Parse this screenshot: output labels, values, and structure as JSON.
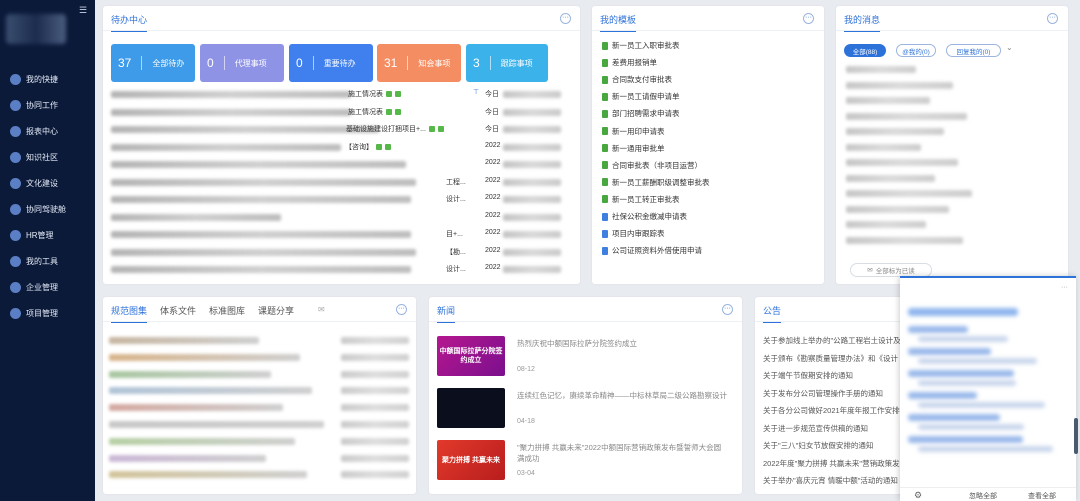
{
  "sidebar": {
    "items": [
      {
        "label": "我的快捷",
        "icon": "shortcut-icon"
      },
      {
        "label": "协同工作",
        "icon": "collaboration-icon"
      },
      {
        "label": "报表中心",
        "icon": "report-icon"
      },
      {
        "label": "知识社区",
        "icon": "graduation-cap-icon"
      },
      {
        "label": "文化建设",
        "icon": "culture-icon"
      },
      {
        "label": "协同驾驶舱",
        "icon": "cockpit-icon"
      },
      {
        "label": "HR管理",
        "icon": "hr-icon"
      },
      {
        "label": "我的工具",
        "icon": "toolbox-icon"
      },
      {
        "label": "企业管理",
        "icon": "enterprise-icon"
      },
      {
        "label": "项目管理",
        "icon": "project-icon"
      }
    ]
  },
  "todo": {
    "title": "待办中心",
    "tiles": [
      {
        "count": "37",
        "label": "全部待办",
        "color": "#3d9be9"
      },
      {
        "count": "0",
        "label": "代理事项",
        "color": "#8f93e6"
      },
      {
        "count": "0",
        "label": "重要待办",
        "color": "#3f80ee"
      },
      {
        "count": "31",
        "label": "知会事项",
        "color": "#f58d63"
      },
      {
        "count": "3",
        "label": "跟踪事项",
        "color": "#3cb2ea"
      }
    ],
    "rows": [
      {
        "title": "施工情况表",
        "date": "今日"
      },
      {
        "title": "施工情况表",
        "date": "今日"
      },
      {
        "title": "基础设施建设打捆项目+...",
        "date": "今日"
      },
      {
        "title": "【咨询】",
        "date": "2022"
      },
      {
        "title": "",
        "date": "2022"
      },
      {
        "title": "工程...",
        "date": "2022"
      },
      {
        "title": "设计...",
        "date": "2022"
      },
      {
        "title": "",
        "date": "2022"
      },
      {
        "title": "目+...",
        "date": "2022"
      },
      {
        "title": "【勘...",
        "date": "2022"
      },
      {
        "title": "设计...",
        "date": "2022"
      }
    ]
  },
  "templates": {
    "title": "我的模板",
    "items": [
      {
        "label": "新一员工入职审批表",
        "color": "green"
      },
      {
        "label": "差费用报销单",
        "color": "green"
      },
      {
        "label": "合同款支付审批表",
        "color": "green"
      },
      {
        "label": "新一员工请假申请单",
        "color": "green"
      },
      {
        "label": "部门招聘需求申请表",
        "color": "green"
      },
      {
        "label": "新一用印申请表",
        "color": "green"
      },
      {
        "label": "新一通用审批单",
        "color": "green"
      },
      {
        "label": "合同审批表（非项目运营）",
        "color": "green"
      },
      {
        "label": "新一员工薪酬职级调整审批表",
        "color": "green"
      },
      {
        "label": "新一员工转正审批表",
        "color": "green"
      },
      {
        "label": "社保公积金缴减申请表",
        "color": "blue"
      },
      {
        "label": "项目内审跟踪表",
        "color": "blue"
      },
      {
        "label": "公司证照资料外借使用申请",
        "color": "blue"
      }
    ]
  },
  "messages": {
    "title": "我的消息",
    "chips": [
      "全部(88)",
      "@我的(0)",
      "回复我的(0)"
    ],
    "mark_all_read": "全部标为已读"
  },
  "knowledge": {
    "tabs": [
      "规范图集",
      "体系文件",
      "标准图库",
      "课题分享"
    ]
  },
  "news": {
    "title": "新闻",
    "items": [
      {
        "thumb_text": "中额国际拉萨分院签约成立",
        "title": "热烈庆祝中额国际拉萨分院签约成立",
        "date": "08-12"
      },
      {
        "thumb_text": "",
        "title": "连续红色记忆，赓续革命精神——中标林草局二级公路勘察设计",
        "date": "04-18"
      },
      {
        "thumb_text": "聚力拼搏 共赢未来",
        "title": "\"聚力拼搏 共赢未来\"2022中额国际营销政策发布暨誓师大会圆满成功",
        "date": "03-04"
      }
    ]
  },
  "notices": {
    "title": "公告",
    "items": [
      "关于参加线上举办的\"公路工程岩土设计及",
      "关于颁布《勘察质量管理办法》和《设计",
      "关于端午节假期安排的通知",
      "关于发布分公司管理操作手册的通知",
      "关于各分公司做好2021年度年报工作安排",
      "关于进一步规范宣传供稿的通知",
      "关于\"三八\"妇女节放假安排的通知",
      "2022年度\"聚力拼搏 共赢未来\"营销政策发",
      "关于举办\"喜庆元宵 情暖中额\"活动的通知"
    ]
  },
  "popup": {
    "ignore_all": "忽略全部",
    "view_all": "查看全部"
  },
  "colors": {
    "accent": "#2d72d9",
    "sidebar_bg": "#0c1a3a"
  }
}
